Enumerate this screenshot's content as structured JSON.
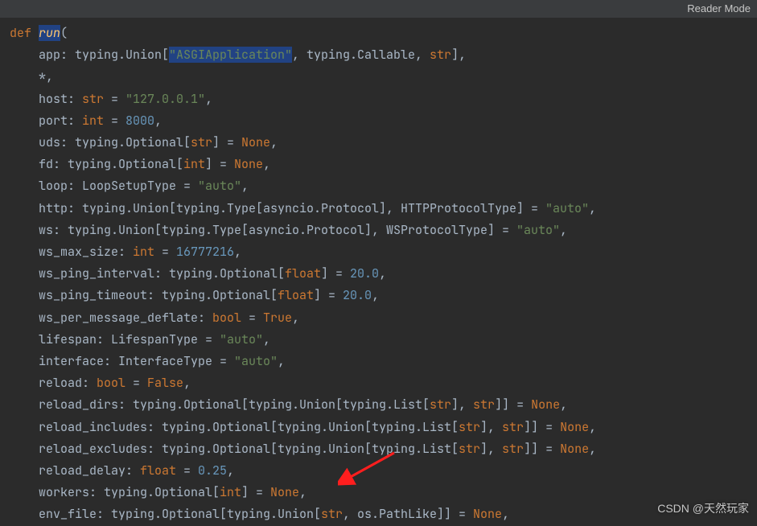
{
  "topbar": {
    "mode": "Reader Mode"
  },
  "code": {
    "l1_def": "def ",
    "l1_fn": "run",
    "l1_p": "(",
    "l2_a": "    app: typing.Union[",
    "l2_s": "\"ASGIApplication\"",
    "l2_b": ", typing.Callable, ",
    "l2_str": "str",
    "l2_c": "],",
    "l3": "    *,",
    "l4_a": "    host: ",
    "l4_str": "str",
    "l4_eq": " = ",
    "l4_s": "\"127.0.0.1\"",
    "l4_c": ",",
    "l5_a": "    port: ",
    "l5_ty": "int",
    "l5_eq": " = ",
    "l5_n": "8000",
    "l5_c": ",",
    "l6_a": "    uds: typing.Optional[",
    "l6_str": "str",
    "l6_b": "] = ",
    "l6_kw": "None",
    "l6_c": ",",
    "l7_a": "    fd: typing.Optional[",
    "l7_ty": "int",
    "l7_b": "] = ",
    "l7_kw": "None",
    "l7_c": ",",
    "l8_a": "    loop: LoopSetupType = ",
    "l8_s": "\"auto\"",
    "l8_c": ",",
    "l9_a": "    http: typing.Union[typing.Type[asyncio.Protocol], HTTPProtocolType] = ",
    "l9_s": "\"auto\"",
    "l9_c": ",",
    "l10_a": "    ws: typing.Union[typing.Type[asyncio.Protocol], WSProtocolType] = ",
    "l10_s": "\"auto\"",
    "l10_c": ",",
    "l11_a": "    ws_max_size: ",
    "l11_ty": "int",
    "l11_eq": " = ",
    "l11_n": "16777216",
    "l11_c": ",",
    "l12_a": "    ws_ping_interval: typing.Optional[",
    "l12_ty": "float",
    "l12_b": "] = ",
    "l12_n": "20.0",
    "l12_c": ",",
    "l13_a": "    ws_ping_timeout: typing.Optional[",
    "l13_ty": "float",
    "l13_b": "] = ",
    "l13_n": "20.0",
    "l13_c": ",",
    "l14_a": "    ws_per_message_deflate: ",
    "l14_ty": "bool",
    "l14_eq": " = ",
    "l14_kw": "True",
    "l14_c": ",",
    "l15_a": "    lifespan: LifespanType = ",
    "l15_s": "\"auto\"",
    "l15_c": ",",
    "l16_a": "    interface: InterfaceType = ",
    "l16_s": "\"auto\"",
    "l16_c": ",",
    "l17_a": "    reload: ",
    "l17_ty": "bool",
    "l17_eq": " = ",
    "l17_kw": "False",
    "l17_c": ",",
    "l18_a": "    reload_dirs: typing.Optional[typing.Union[typing.List[",
    "l18_str1": "str",
    "l18_b": "], ",
    "l18_str2": "str",
    "l18_c": "]] = ",
    "l18_kw": "None",
    "l18_d": ",",
    "l19_a": "    reload_includes: typing.Optional[typing.Union[typing.List[",
    "l19_str1": "str",
    "l19_b": "], ",
    "l19_str2": "str",
    "l19_c": "]] = ",
    "l19_kw": "None",
    "l19_d": ",",
    "l20_a": "    reload_excludes: typing.Optional[typing.Union[typing.List[",
    "l20_str1": "str",
    "l20_b": "], ",
    "l20_str2": "str",
    "l20_c": "]] = ",
    "l20_kw": "None",
    "l20_d": ",",
    "l21_a": "    reload_delay: ",
    "l21_ty": "float",
    "l21_eq": " = ",
    "l21_n": "0.25",
    "l21_c": ",",
    "l22_a": "    workers: typing.Optional[",
    "l22_ty": "int",
    "l22_b": "] = ",
    "l22_kw": "None",
    "l22_c": ",",
    "l23_a": "    env_file: typing.Optional[typing.Union[",
    "l23_str": "str",
    "l23_b": ", os.PathLike]] = ",
    "l23_kw": "None",
    "l23_c": ","
  },
  "watermark": "CSDN @天然玩家"
}
